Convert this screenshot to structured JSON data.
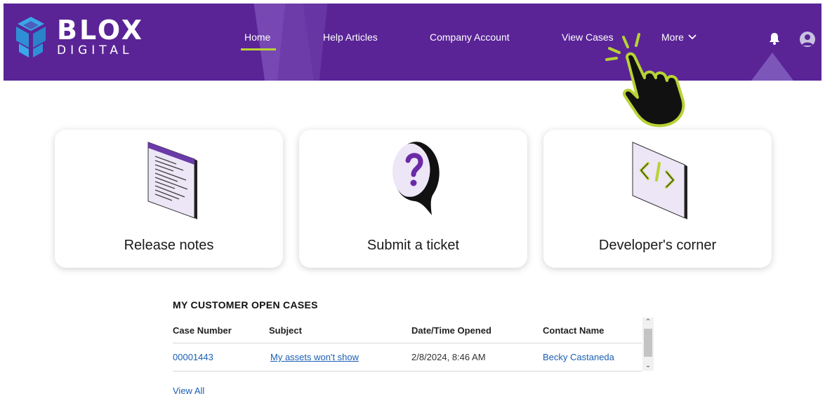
{
  "brand": {
    "name_top": "BLOX",
    "name_bottom": "DIGITAL"
  },
  "nav": {
    "home": "Home",
    "help_articles": "Help Articles",
    "company_account": "Company Account",
    "view_cases": "View Cases",
    "more": "More"
  },
  "icons": {
    "notifications": "bell-icon",
    "user": "avatar-icon",
    "more_caret": "chevron-down-icon",
    "pointer": "pointing-hand-icon"
  },
  "colors": {
    "header_bg": "#5a2497",
    "accent_green": "#b8d334",
    "link_blue": "#1a5fb4"
  },
  "cards": [
    {
      "label": "Release notes"
    },
    {
      "label": "Submit a ticket"
    },
    {
      "label": "Developer's corner"
    }
  ],
  "cases": {
    "title": "MY CUSTOMER OPEN CASES",
    "columns": [
      "Case Number",
      "Subject",
      "Date/Time Opened",
      "Contact Name"
    ],
    "rows": [
      {
        "case_number": "00001443",
        "subject": "My assets won't show",
        "opened": "2/8/2024, 8:46 AM",
        "contact": "Becky Castaneda"
      }
    ],
    "view_all": "View All"
  }
}
